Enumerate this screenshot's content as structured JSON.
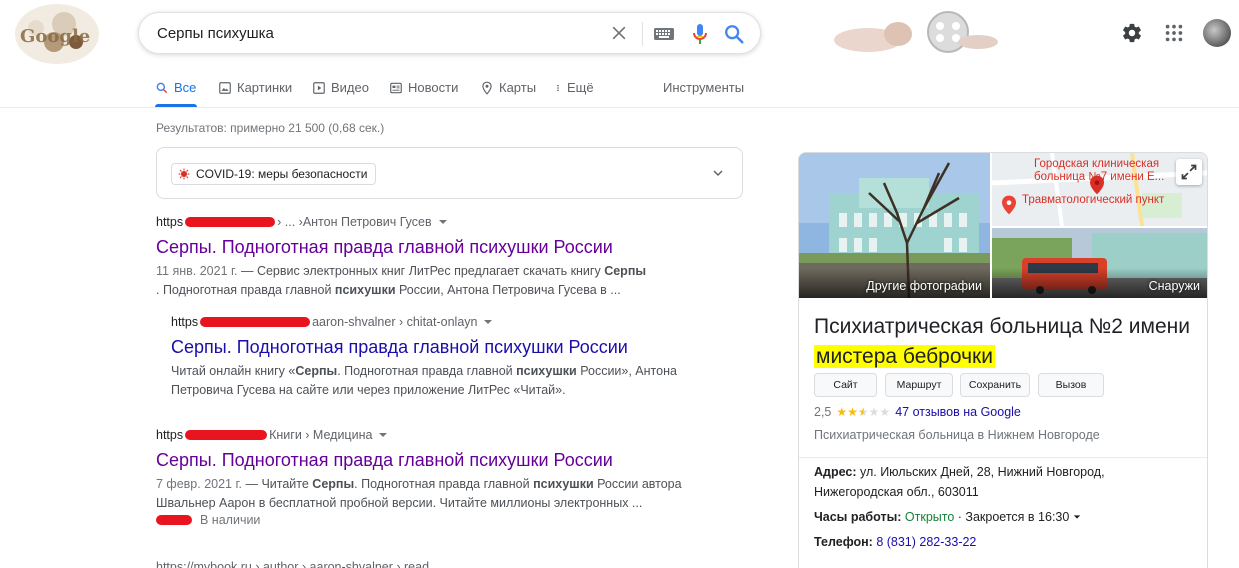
{
  "header": {
    "logo_text": "Google",
    "query": "Серпы психушка"
  },
  "tabs": [
    {
      "label": "Все",
      "icon": "search-icon",
      "active": true
    },
    {
      "label": "Картинки",
      "icon": "image-icon"
    },
    {
      "label": "Видео",
      "icon": "video-icon"
    },
    {
      "label": "Новости",
      "icon": "news-icon"
    },
    {
      "label": "Карты",
      "icon": "map-pin-icon"
    },
    {
      "label": "Ещё",
      "icon": "more-vert-icon"
    }
  ],
  "tools_label": "Инструменты",
  "stats": "Результатов: примерно 21 500 (0,68 сек.)",
  "covid": {
    "label": "COVID-19: меры безопасности"
  },
  "results": [
    {
      "cite_prefix": "https",
      "cite_mid": " › ... › ",
      "cite_tail": "Антон Петрович Гусев",
      "title": "Серпы. Подноготная правда главной психушки России",
      "date": "11 янв. 2021 г.",
      "snippet_1": " — Сервис электронных книг ЛитРес предлагает скачать книгу ",
      "snippet_b1": "Серпы",
      "snippet_2": ". Подноготная правда главной ",
      "snippet_b2": "психушки",
      "snippet_3": " России, Антона Петровича Гусева в ..."
    },
    {
      "cite_prefix": "https",
      "cite_tail": "aaron-shvalner › chitat-onlayn",
      "title": "Серпы. Подноготная правда главной психушки России",
      "snippet_1": "Читай онлайн книгу «",
      "snippet_b1": "Серпы",
      "snippet_2": ". Подноготная правда главной ",
      "snippet_b2": "психушки",
      "snippet_3": " России», Антона Петровича Гусева на сайте или через приложение ЛитРес «Читай»."
    },
    {
      "cite_prefix": "https",
      "cite_tail": "Книги › Медицина",
      "title": "Серпы. Подноготная правда главной психушки России",
      "date": "7 февр. 2021 г.",
      "snippet_1": " — Читайте ",
      "snippet_b1": "Серпы",
      "snippet_2": ". Подноготная правда главной ",
      "snippet_b2": "психушки",
      "snippet_3": " России автора Швальнер Аарон в бесплатной пробной версии. Читайте миллионы электронных ...",
      "availability": "В наличии"
    },
    {
      "cite_prefix": "https://mybook.ru › author › aaron-shvalner › read"
    }
  ],
  "knowledge_panel": {
    "more_photos_label": "Другие фотографии",
    "outside_label": "Снаружи",
    "map_label_1": "Городская клиническая больница №7 имени Е...",
    "map_label_2": "Травматологический пункт",
    "name_plain": "Психиатрическая больница №2 имени ",
    "name_highlight": "мистера беброчки",
    "buttons": [
      "Сайт",
      "Маршрут",
      "Сохранить",
      "Вызов"
    ],
    "rating_value": "2,5",
    "rating": 2.5,
    "reviews": "47 отзывов на Google",
    "category": "Психиатрическая больница в Нижнем Новгороде",
    "address_label": "Адрес:",
    "address": "ул. Июльских Дней, 28, Нижний Новгород, Нижегородская обл., 603011",
    "hours_label": "Часы работы:",
    "hours_open": "Открыто",
    "hours_close": "· Закроется в 16:30",
    "phone_label": "Телефон:",
    "phone": "8 (831) 282-33-22"
  },
  "colors": {
    "link": "#1a0dab",
    "visited": "#660099",
    "accent": "#1a73e8",
    "highlight": "#ffff00",
    "redaction": "#e8141f"
  }
}
